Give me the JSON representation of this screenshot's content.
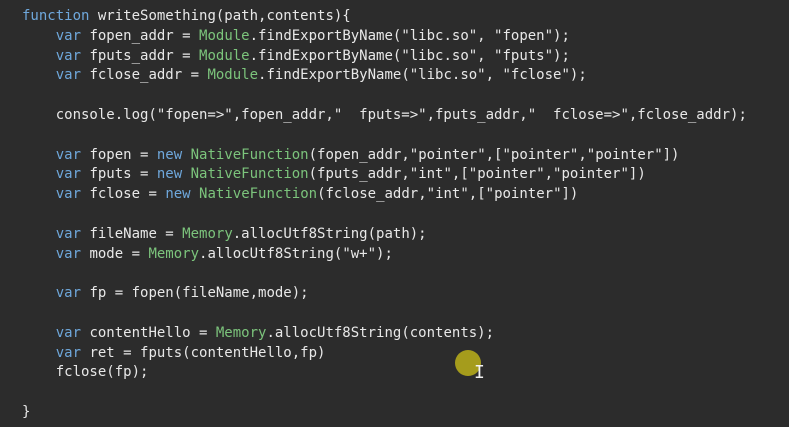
{
  "code": {
    "lines": [
      [
        {
          "t": "function",
          "c": "kw"
        },
        {
          "t": " writeSomething(path,contents){",
          "c": "txt"
        }
      ],
      [
        {
          "t": "    ",
          "c": "txt"
        },
        {
          "t": "var",
          "c": "kw"
        },
        {
          "t": " fopen_addr = ",
          "c": "txt"
        },
        {
          "t": "Module",
          "c": "cls"
        },
        {
          "t": ".findExportByName(\"libc.so\", \"fopen\");",
          "c": "txt"
        }
      ],
      [
        {
          "t": "    ",
          "c": "txt"
        },
        {
          "t": "var",
          "c": "kw"
        },
        {
          "t": " fputs_addr = ",
          "c": "txt"
        },
        {
          "t": "Module",
          "c": "cls"
        },
        {
          "t": ".findExportByName(\"libc.so\", \"fputs\");",
          "c": "txt"
        }
      ],
      [
        {
          "t": "    ",
          "c": "txt"
        },
        {
          "t": "var",
          "c": "kw"
        },
        {
          "t": " fclose_addr = ",
          "c": "txt"
        },
        {
          "t": "Module",
          "c": "cls"
        },
        {
          "t": ".findExportByName(\"libc.so\", \"fclose\");",
          "c": "txt"
        }
      ],
      [],
      [
        {
          "t": "    console.log(\"fopen=>\",fopen_addr,\"  fputs=>\",fputs_addr,\"  fclose=>\",fclose_addr);",
          "c": "txt"
        }
      ],
      [],
      [
        {
          "t": "    ",
          "c": "txt"
        },
        {
          "t": "var",
          "c": "kw"
        },
        {
          "t": " fopen = ",
          "c": "txt"
        },
        {
          "t": "new",
          "c": "kw"
        },
        {
          "t": " ",
          "c": "txt"
        },
        {
          "t": "NativeFunction",
          "c": "cls"
        },
        {
          "t": "(fopen_addr,\"pointer\",[\"pointer\",\"pointer\"])",
          "c": "txt"
        }
      ],
      [
        {
          "t": "    ",
          "c": "txt"
        },
        {
          "t": "var",
          "c": "kw"
        },
        {
          "t": " fputs = ",
          "c": "txt"
        },
        {
          "t": "new",
          "c": "kw"
        },
        {
          "t": " ",
          "c": "txt"
        },
        {
          "t": "NativeFunction",
          "c": "cls"
        },
        {
          "t": "(fputs_addr,\"int\",[\"pointer\",\"pointer\"])",
          "c": "txt"
        }
      ],
      [
        {
          "t": "    ",
          "c": "txt"
        },
        {
          "t": "var",
          "c": "kw"
        },
        {
          "t": " fclose = ",
          "c": "txt"
        },
        {
          "t": "new",
          "c": "kw"
        },
        {
          "t": " ",
          "c": "txt"
        },
        {
          "t": "NativeFunction",
          "c": "cls"
        },
        {
          "t": "(fclose_addr,\"int\",[\"pointer\"])",
          "c": "txt"
        }
      ],
      [],
      [
        {
          "t": "    ",
          "c": "txt"
        },
        {
          "t": "var",
          "c": "kw"
        },
        {
          "t": " fileName = ",
          "c": "txt"
        },
        {
          "t": "Memory",
          "c": "cls"
        },
        {
          "t": ".allocUtf8String(path);",
          "c": "txt"
        }
      ],
      [
        {
          "t": "    ",
          "c": "txt"
        },
        {
          "t": "var",
          "c": "kw"
        },
        {
          "t": " mode = ",
          "c": "txt"
        },
        {
          "t": "Memory",
          "c": "cls"
        },
        {
          "t": ".allocUtf8String(\"w+\");",
          "c": "txt"
        }
      ],
      [],
      [
        {
          "t": "    ",
          "c": "txt"
        },
        {
          "t": "var",
          "c": "kw"
        },
        {
          "t": " fp = fopen(fileName,mode);",
          "c": "txt"
        }
      ],
      [],
      [
        {
          "t": "    ",
          "c": "txt"
        },
        {
          "t": "var",
          "c": "kw"
        },
        {
          "t": " contentHello = ",
          "c": "txt"
        },
        {
          "t": "Memory",
          "c": "cls"
        },
        {
          "t": ".allocUtf8String(contents);",
          "c": "txt"
        }
      ],
      [
        {
          "t": "    ",
          "c": "txt"
        },
        {
          "t": "var",
          "c": "kw"
        },
        {
          "t": " ret = fputs(contentHello,fp)",
          "c": "txt"
        }
      ],
      [
        {
          "t": "    fclose(fp);",
          "c": "txt"
        }
      ],
      [],
      [
        {
          "t": "}",
          "c": "txt"
        }
      ]
    ]
  },
  "colors": {
    "background": "#2c2c2c",
    "keyword": "#6fa8dc",
    "class_name": "#7cc47c",
    "text": "#e8e8e8",
    "mouse_highlight": "#b3a81b"
  },
  "icons": {
    "mouse_highlight": "mouse-highlight-dot",
    "text_cursor": "i-beam-cursor-icon",
    "text_cursor_glyph": "I"
  }
}
